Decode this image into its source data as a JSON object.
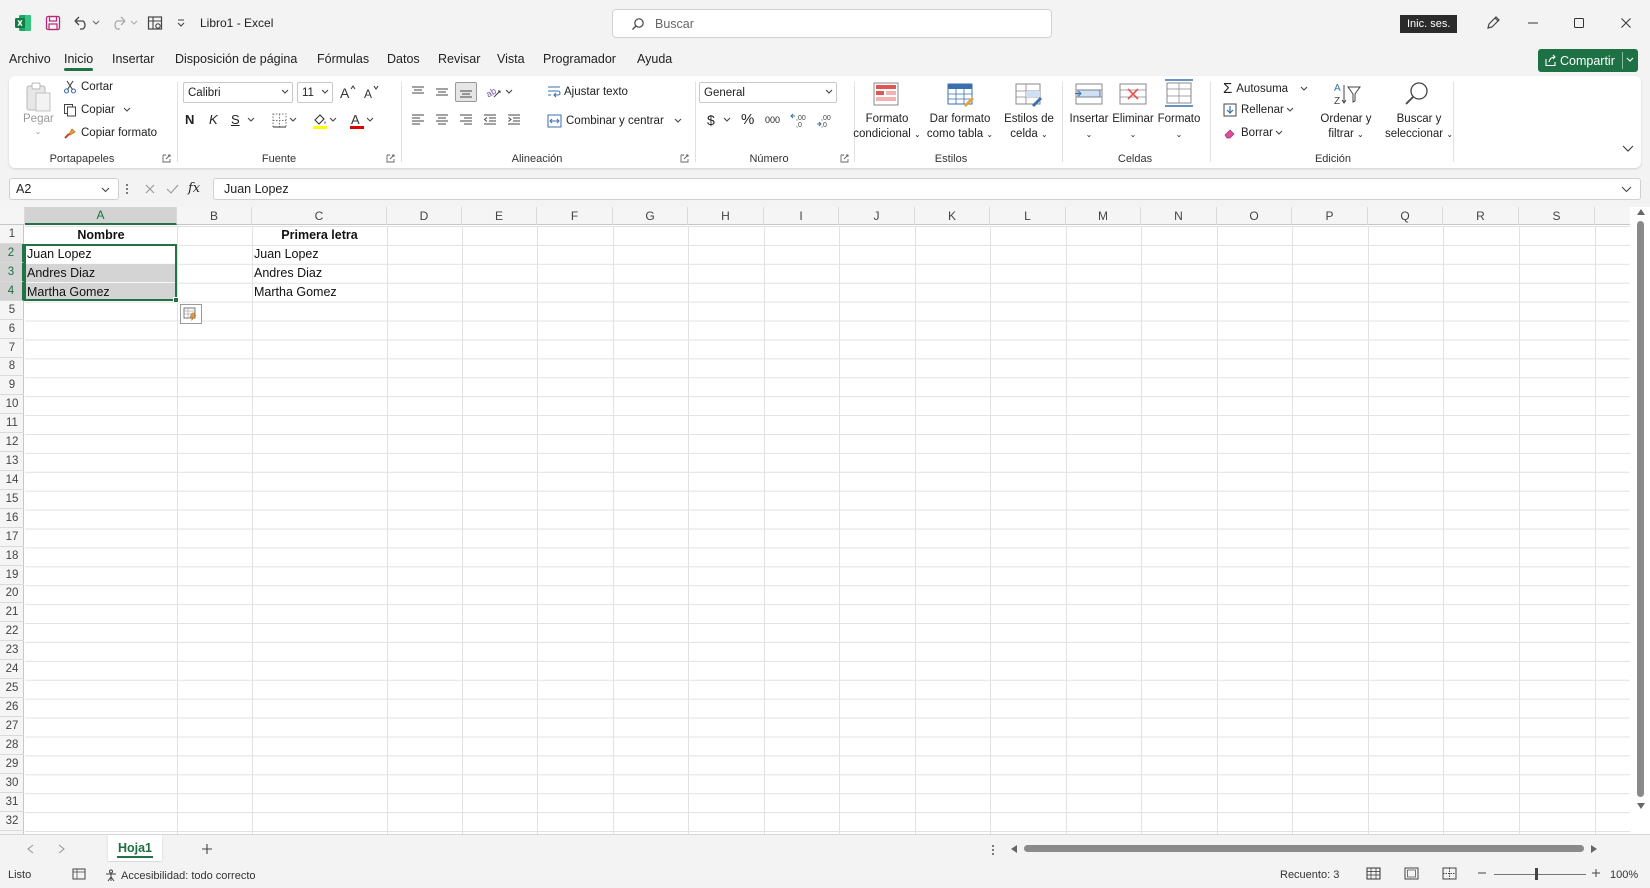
{
  "window": {
    "title": "Libro1  -  Excel",
    "search_placeholder": "Buscar",
    "signin_label": "Inic. ses."
  },
  "menu": {
    "tabs": [
      "Archivo",
      "Inicio",
      "Insertar",
      "Disposición de página",
      "Fórmulas",
      "Datos",
      "Revisar",
      "Vista",
      "Programador",
      "Ayuda"
    ],
    "active_tab": "Inicio",
    "share_label": "Compartir"
  },
  "ribbon": {
    "clipboard": {
      "label": "Portapapeles",
      "paste": "Pegar",
      "cut": "Cortar",
      "copy": "Copiar",
      "format_painter": "Copiar formato"
    },
    "font": {
      "label": "Fuente",
      "family": "Calibri",
      "size": "11",
      "bold": "N",
      "italic": "K",
      "underline": "S"
    },
    "alignment": {
      "label": "Alineación",
      "wrap": "Ajustar texto",
      "merge": "Combinar y centrar"
    },
    "number": {
      "label": "Número",
      "format": "General",
      "currency": "$",
      "percent": "%",
      "thousands": "000"
    },
    "styles": {
      "label": "Estilos",
      "conditional": [
        "Formato",
        "condicional"
      ],
      "as_table": [
        "Dar formato",
        "como tabla"
      ],
      "cell_styles": [
        "Estilos de",
        "celda"
      ]
    },
    "cells": {
      "label": "Celdas",
      "insert": "Insertar",
      "delete": "Eliminar",
      "format": "Formato"
    },
    "editing": {
      "label": "Edición",
      "autosum": "Autosuma",
      "fill": "Rellenar",
      "clear": "Borrar",
      "sort": [
        "Ordenar y",
        "filtrar"
      ],
      "find": [
        "Buscar y",
        "seleccionar"
      ]
    }
  },
  "formula_bar": {
    "name_box": "A2",
    "fx": "fx",
    "content": "Juan Lopez"
  },
  "grid": {
    "columns": [
      "A",
      "B",
      "C",
      "D",
      "E",
      "F",
      "G",
      "H",
      "I",
      "J",
      "K",
      "L",
      "M",
      "N",
      "O",
      "P",
      "Q",
      "R",
      "S"
    ],
    "rows": [
      "1",
      "2",
      "3",
      "4",
      "5",
      "6",
      "7",
      "8",
      "9",
      "10",
      "11",
      "12",
      "13",
      "14",
      "15",
      "16",
      "17",
      "18",
      "19",
      "20",
      "21",
      "22",
      "23",
      "24",
      "25",
      "26",
      "27",
      "28",
      "29",
      "30",
      "31",
      "32"
    ],
    "cells": {
      "A1": "Nombre",
      "C1": "Primera letra",
      "A2": "Juan Lopez",
      "A3": "Andres Diaz",
      "A4": "Martha Gomez",
      "C2": "Juan Lopez",
      "C3": "Andres Diaz",
      "C4": "Martha Gomez"
    },
    "selected_range": "A2:A4",
    "accent": "#217346"
  },
  "sheets": {
    "tabs": [
      "Hoja1"
    ],
    "active": "Hoja1"
  },
  "status": {
    "mode": "Listo",
    "accessibility": "Accesibilidad: todo correcto",
    "count": "Recuento: 3",
    "zoom": "100%"
  }
}
